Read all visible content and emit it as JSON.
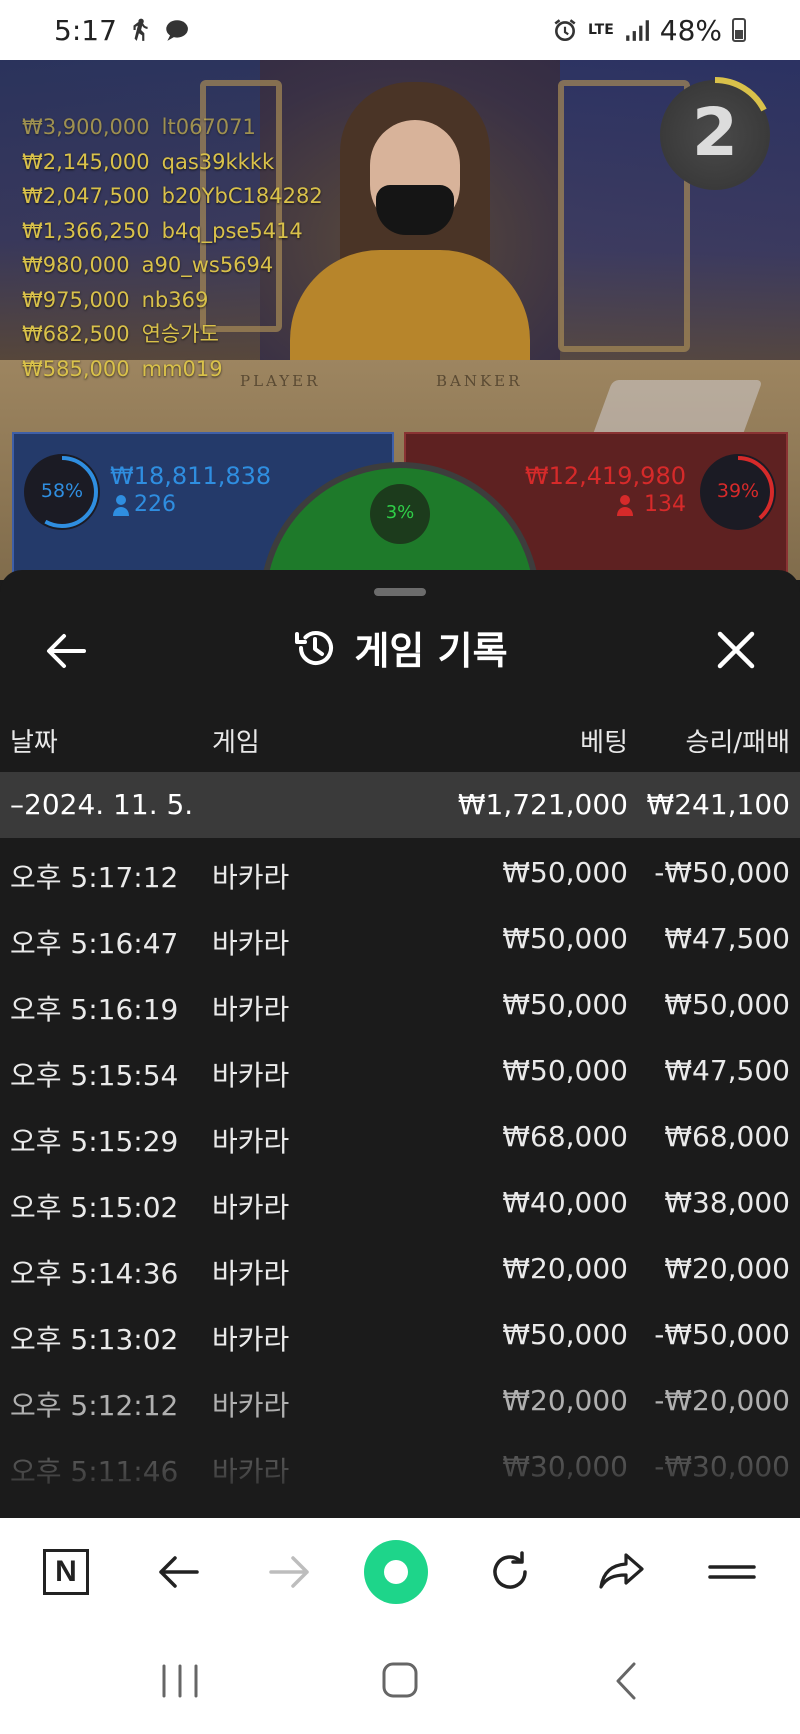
{
  "status_bar": {
    "time": "5:17",
    "network": "LTE",
    "battery": "48%"
  },
  "game": {
    "round": "2",
    "table_labels": {
      "player": "PLAYER",
      "banker": "BANKER"
    },
    "leaderboard": [
      {
        "amount": "₩3,900,000",
        "user": "lt067071"
      },
      {
        "amount": "₩2,145,000",
        "user": "qas39kkkk"
      },
      {
        "amount": "₩2,047,500",
        "user": "b20YbC184282"
      },
      {
        "amount": "₩1,366,250",
        "user": "b4q_pse5414"
      },
      {
        "amount": "₩980,000",
        "user": "a90_ws5694"
      },
      {
        "amount": "₩975,000",
        "user": "nb369"
      },
      {
        "amount": "₩682,500",
        "user": "연승가도"
      },
      {
        "amount": "₩585,000",
        "user": "mm019"
      }
    ],
    "player_bets": {
      "percent": "58%",
      "amount": "₩18,811,838",
      "count": "226",
      "color": "#2f8ee0"
    },
    "banker_bets": {
      "percent": "39%",
      "amount": "₩12,419,980",
      "count": "134",
      "color": "#d62a2a"
    },
    "tie_bets": {
      "percent": "3%",
      "color": "#2fcf48"
    }
  },
  "history": {
    "title": "게임 기록",
    "columns": {
      "date": "날짜",
      "game": "게임",
      "bet": "베팅",
      "win_loss": "승리/패배"
    },
    "date_group": {
      "label": "–2024. 11. 5.",
      "bet_total": "₩1,721,000",
      "win_loss_total": "₩241,100"
    },
    "rows": [
      {
        "time": "오후 5:17:12",
        "game": "바카라",
        "bet": "₩50,000",
        "result": "-₩50,000"
      },
      {
        "time": "오후 5:16:47",
        "game": "바카라",
        "bet": "₩50,000",
        "result": "₩47,500"
      },
      {
        "time": "오후 5:16:19",
        "game": "바카라",
        "bet": "₩50,000",
        "result": "₩50,000"
      },
      {
        "time": "오후 5:15:54",
        "game": "바카라",
        "bet": "₩50,000",
        "result": "₩47,500"
      },
      {
        "time": "오후 5:15:29",
        "game": "바카라",
        "bet": "₩68,000",
        "result": "₩68,000"
      },
      {
        "time": "오후 5:15:02",
        "game": "바카라",
        "bet": "₩40,000",
        "result": "₩38,000"
      },
      {
        "time": "오후 5:14:36",
        "game": "바카라",
        "bet": "₩20,000",
        "result": "₩20,000"
      },
      {
        "time": "오후 5:13:02",
        "game": "바카라",
        "bet": "₩50,000",
        "result": "-₩50,000"
      },
      {
        "time": "오후 5:12:12",
        "game": "바카라",
        "bet": "₩20,000",
        "result": "-₩20,000"
      },
      {
        "time": "오후 5:11:46",
        "game": "바카라",
        "bet": "₩30,000",
        "result": "-₩30,000"
      }
    ]
  },
  "browser_bar": {
    "logo": "N",
    "home_color": "#1ed58a"
  }
}
